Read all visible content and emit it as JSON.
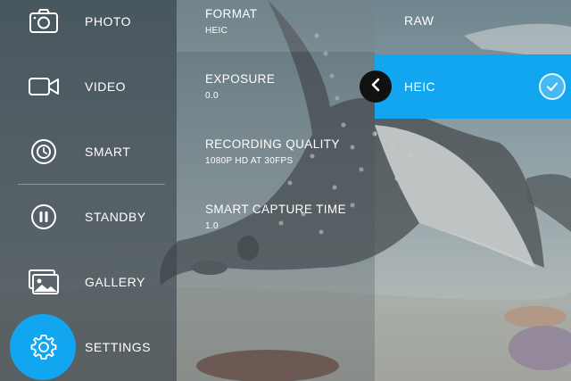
{
  "menu": {
    "items": [
      {
        "label": "PHOTO",
        "icon": "camera-icon"
      },
      {
        "label": "VIDEO",
        "icon": "video-camera-icon"
      },
      {
        "label": "SMART",
        "icon": "smart-capture-icon"
      },
      {
        "label": "STANDBY",
        "icon": "pause-icon"
      },
      {
        "label": "GALLERY",
        "icon": "gallery-icon"
      },
      {
        "label": "SETTINGS",
        "icon": "gear-icon"
      }
    ],
    "active": "SETTINGS"
  },
  "settings": [
    {
      "name": "FORMAT",
      "value": "HEIC"
    },
    {
      "name": "EXPOSURE",
      "value": "0.0"
    },
    {
      "name": "RECORDING QUALITY",
      "value": "1080P HD AT 30FPS"
    },
    {
      "name": "SMART CAPTURE TIME",
      "value": "1.0"
    }
  ],
  "format_options": [
    {
      "label": "RAW",
      "selected": false
    },
    {
      "label": "HEIC",
      "selected": true
    }
  ],
  "colors": {
    "accent": "#11a6ef"
  }
}
